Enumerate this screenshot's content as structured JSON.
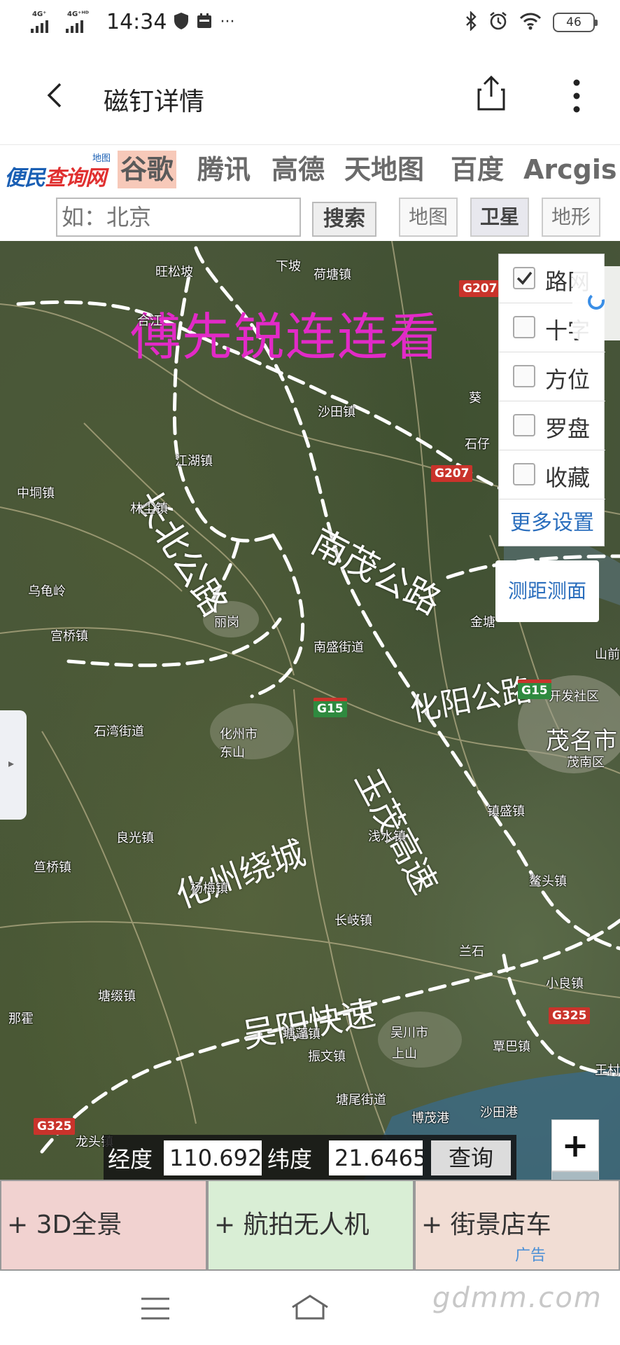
{
  "status": {
    "time": "14:34",
    "net1": "4G⁺",
    "net2": "4G⁺ᴴᴰ",
    "more": "···",
    "battery": "46"
  },
  "header": {
    "title": "磁钉详情"
  },
  "providers": {
    "logo_main_a": "便民",
    "logo_main_b": "查询网",
    "logo_tag": "地图",
    "items": [
      {
        "label": "谷歌",
        "active": true
      },
      {
        "label": "腾讯"
      },
      {
        "label": "高德"
      },
      {
        "label": "天地图"
      },
      {
        "label": "百度"
      },
      {
        "label": "Arcgis"
      }
    ]
  },
  "search": {
    "placeholder": "如：北京",
    "button": "搜索",
    "map_types": [
      {
        "label": "地图"
      },
      {
        "label": "卫星",
        "active": true
      },
      {
        "label": "地形"
      }
    ]
  },
  "map": {
    "headline": "傅先锐连连看",
    "roads": {
      "changbei": "长北公路",
      "nanmao": "南茂公路",
      "huayang": "化阳公路",
      "yumao": "玉茂高速",
      "huazhou": "化州绕城",
      "wuyang": "吴阳快速"
    },
    "places": {
      "wangsongpo": "旺松坡",
      "xiapo": "下坡",
      "hetangzhen": "荷塘镇",
      "bayi": "合江",
      "shatianzhen": "沙田镇",
      "jiangbianzhen": "江湖镇",
      "shizi": "石仔",
      "zhongdongzhen": "中垌镇",
      "linchenzhen": "林尘镇",
      "tanzhen": "鉴",
      "wutaling": "乌龟岭",
      "yiqiaozhen": "宫桥镇",
      "lishan": "丽岗",
      "nanshengjiedao": "南盛街道",
      "jinshan": "金塘",
      "shanqian": "山前",
      "zhuchuanjie": "石湾街道",
      "huazhoushi": "化州市",
      "dongshan": "东山",
      "moyu": "茂名市",
      "maonan": "茂南区",
      "kaizheng": "开发社区",
      "liangguang": "良光镇",
      "lianjiang": "笪桥镇",
      "yangmei": "杨梅镇",
      "qianshui": "浅水镇",
      "zhenshengzhen": "镇盛镇",
      "lingtou": "鳌头镇",
      "dongpo": "长岐镇",
      "lanshi": "兰石",
      "tanghuan": "塘缀镇",
      "nanpeng": "那霍",
      "xiaoliang": "小良镇",
      "wuchuan": "吴川市",
      "shangshan": "上山",
      "zhenwen": "振文镇",
      "qinba": "覃巴镇",
      "zhedu": "博茂港",
      "shatiangang": "沙田港",
      "dongwei": "塘尾街道",
      "longtou": "龙头镇",
      "xingzhen": "塘蓬镇",
      "wangzhen": "王村",
      "kuijiang": "葵"
    },
    "shields": {
      "g207a": "G207",
      "g207b": "G207",
      "g15a": "G15",
      "g15b": "G15",
      "g325a": "G325",
      "g325b": "G325"
    },
    "layers": [
      {
        "label": "路网",
        "checked": true
      },
      {
        "label": "十字",
        "checked": false
      },
      {
        "label": "方位",
        "checked": false
      },
      {
        "label": "罗盘",
        "checked": false
      },
      {
        "label": "收藏",
        "checked": false
      }
    ],
    "layers_more": "更多设置",
    "measure": "测距测面",
    "side_tab": "▸",
    "coords": {
      "lng_label": "经度",
      "lng_value": "110.692",
      "lat_label": "纬度",
      "lat_value": "21.6465",
      "query": "查询"
    },
    "zoom_in": "+",
    "zoom_out": "−"
  },
  "promos": [
    {
      "label": "+ 3D全景",
      "color": "#f1d2d0"
    },
    {
      "label": "+ 航拍无人机",
      "color": "#d9eed5"
    },
    {
      "label": "+ 街景店车",
      "color": "#f1ddd4"
    }
  ],
  "ad_mark": "广告",
  "watermark": "gdmm.com"
}
